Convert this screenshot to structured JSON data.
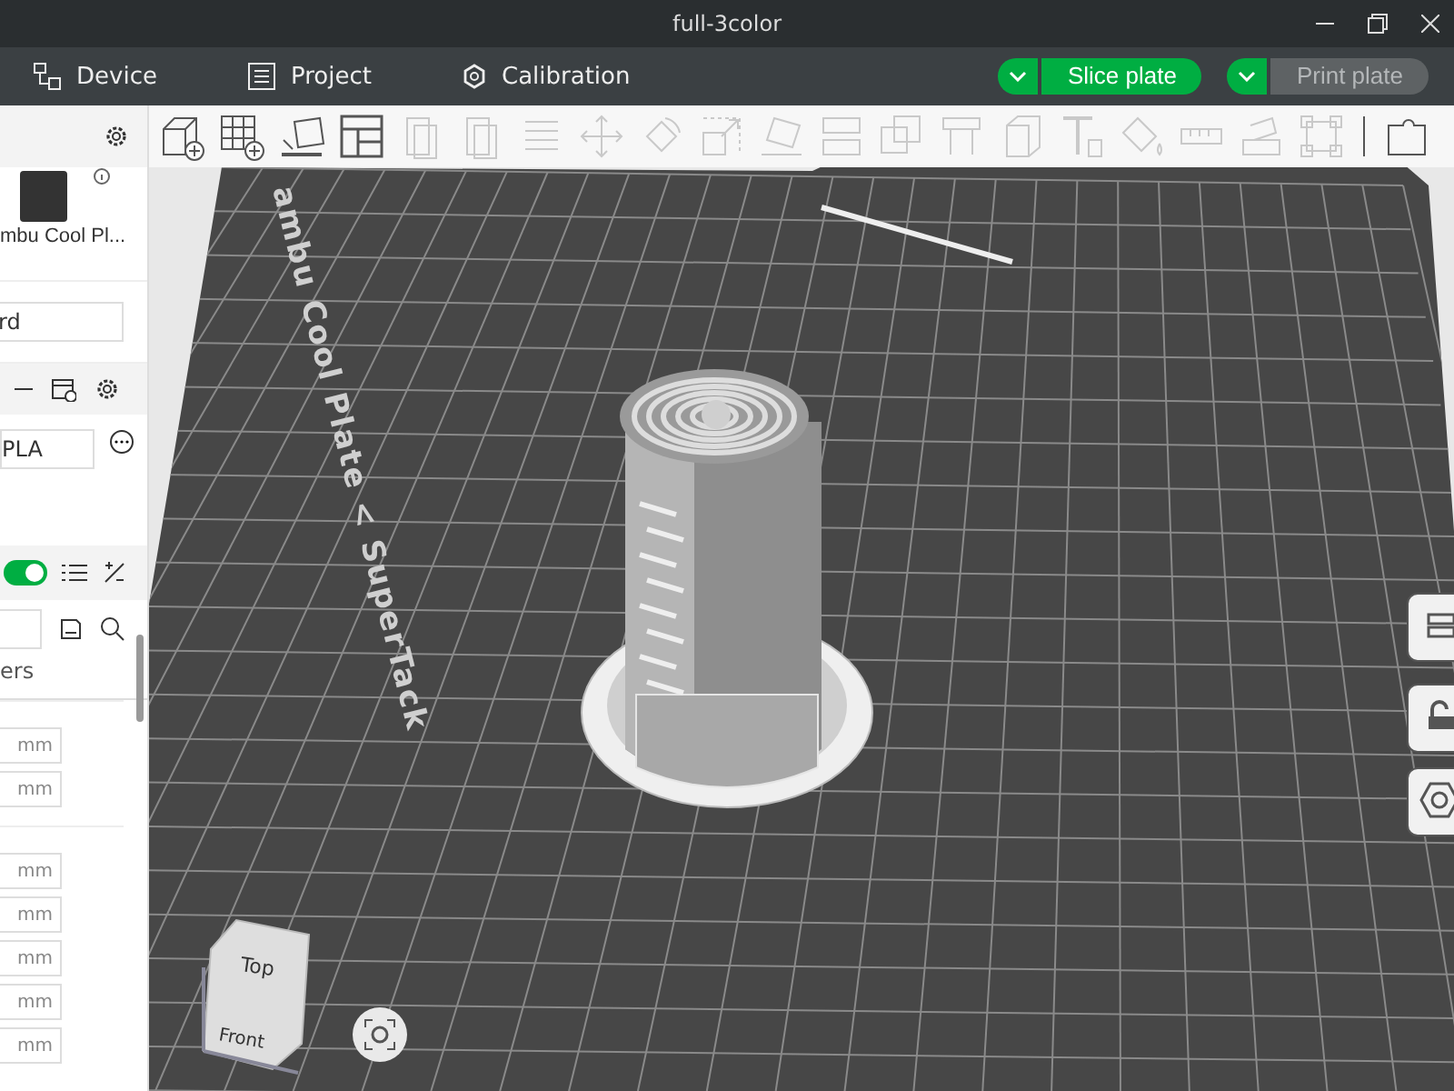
{
  "window": {
    "title": "full-3color"
  },
  "menu": [
    {
      "label": "Device",
      "kind": "device"
    },
    {
      "label": "Project",
      "kind": "project"
    },
    {
      "label": "Calibration",
      "kind": "calibration"
    }
  ],
  "actions": [
    {
      "label": "Slice plate",
      "disabled": false
    },
    {
      "label": "Print plate",
      "disabled": true
    }
  ],
  "sidebar": {
    "plate_name": "mbu Cool Pl...",
    "field_value": "rd",
    "filament": "PLA",
    "toggle_on": true,
    "tab_label": "ers",
    "groups": [
      {
        "units": [
          "mm",
          "mm"
        ]
      },
      {
        "units": [
          "mm",
          "mm",
          "mm",
          "mm",
          "mm"
        ]
      }
    ]
  },
  "viewport": {
    "plate_label": "ambu Cool Plate < SuperTack",
    "cube_faces": {
      "top": "Top",
      "front": "Front"
    }
  }
}
